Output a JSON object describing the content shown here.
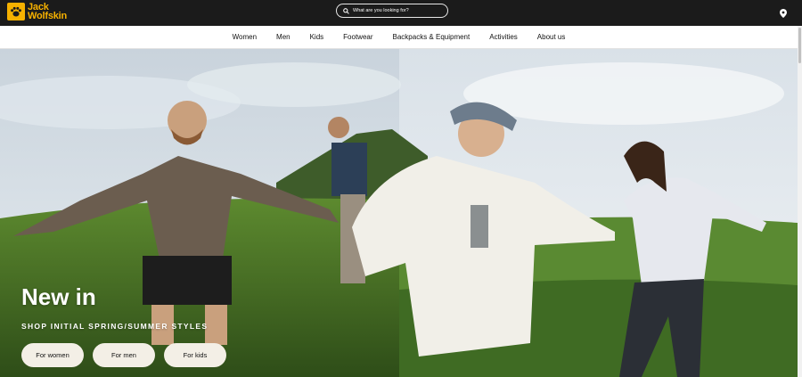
{
  "brand": {
    "name_line1": "Jack",
    "name_line2": "Wolfskin",
    "logo_color": "#f6b100"
  },
  "search": {
    "placeholder": "What are you looking for?",
    "icon": "search-icon"
  },
  "header": {
    "location_icon": "map-pin-icon",
    "bar_color": "#1b1b1b"
  },
  "nav": {
    "items": [
      {
        "label": "Women"
      },
      {
        "label": "Men"
      },
      {
        "label": "Kids"
      },
      {
        "label": "Footwear"
      },
      {
        "label": "Backpacks & Equipment"
      },
      {
        "label": "Activities"
      },
      {
        "label": "About us"
      }
    ]
  },
  "hero": {
    "title": "New in",
    "subtitle": "SHOP INITIAL SPRING/SUMMER STYLES",
    "buttons": [
      {
        "label": "For women"
      },
      {
        "label": "For men"
      },
      {
        "label": "For kids"
      }
    ],
    "button_color": "#f3efe6"
  }
}
